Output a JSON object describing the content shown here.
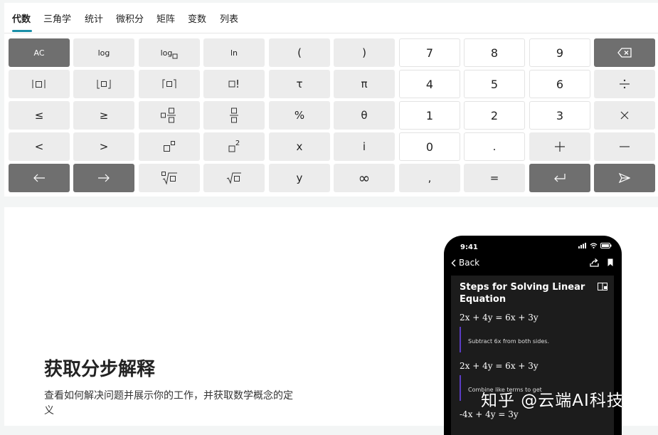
{
  "tabs": [
    {
      "label": "代数",
      "active": true
    },
    {
      "label": "三角学"
    },
    {
      "label": "统计"
    },
    {
      "label": "微积分"
    },
    {
      "label": "矩阵"
    },
    {
      "label": "变数"
    },
    {
      "label": "列表"
    }
  ],
  "keypad": {
    "ac": "AC",
    "log": "log",
    "log_base": "log",
    "ln": "ln",
    "lparen": "(",
    "rparen": ")",
    "seven": "7",
    "eight": "8",
    "nine": "9",
    "factorial_mark": "!",
    "tau": "τ",
    "pi": "π",
    "four": "4",
    "five": "5",
    "six": "6",
    "le": "≤",
    "ge": "≥",
    "percent": "%",
    "theta": "θ",
    "one": "1",
    "two": "2",
    "three": "3",
    "lt": "<",
    "gt": ">",
    "sq_exp": "2",
    "x": "x",
    "i": "i",
    "zero": "0",
    "dot": ".",
    "y": "y",
    "infinity": "∞",
    "comma": ",",
    "equals": "="
  },
  "colors": {
    "accent": "#1a8fa8",
    "key_dark": "#6f6f6f",
    "key_light": "#ececec",
    "step_bar": "#5b3cc4"
  },
  "feature": {
    "heading": "获取分步解释",
    "description": "查看如何解决问题并展示你的工作，并获取数学概念的定义"
  },
  "phone": {
    "time": "9:41",
    "back_label": "Back",
    "title": "Steps for Solving Linear Equation",
    "eq1": "2x + 4y = 6x + 3y",
    "step1": "Subtract 6x from both sides.",
    "eq2": "2x + 4y = 6x + 3y",
    "step2": "Combine like terms to get",
    "eq3": "-4x + 4y = 3y"
  },
  "watermark": "知乎 @云端AI科技"
}
